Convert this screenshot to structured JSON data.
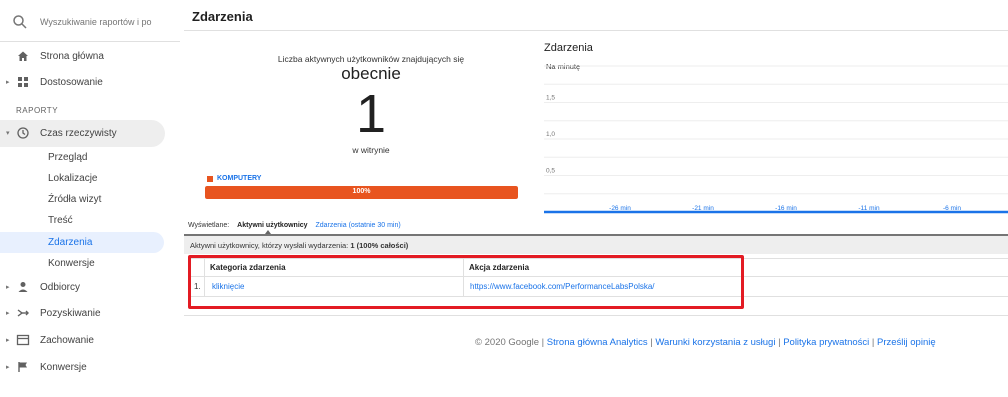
{
  "search": {
    "placeholder": "Wyszukiwanie raportów i po"
  },
  "sidebar": {
    "home": "Strona główna",
    "customize": "Dostosowanie",
    "section_reports": "RAPORTY",
    "realtime": "Czas rzeczywisty",
    "realtime_items": [
      "Przegląd",
      "Lokalizacje",
      "Źródła wizyt",
      "Treść",
      "Zdarzenia",
      "Konwersje"
    ],
    "active_item": "Zdarzenia",
    "audience": "Odbiorcy",
    "acquisition": "Pozyskiwanie",
    "behavior": "Zachowanie",
    "conversions": "Konwersje"
  },
  "page": {
    "title": "Zdarzenia"
  },
  "active_users": {
    "caption": "Liczba aktywnych użytkowników znajdujących się",
    "now": "obecnie",
    "count": "1",
    "on_site": "w witrynie",
    "device": "KOMPUTERY",
    "device_share_label": "100%",
    "device_share": 1.0,
    "device_color": "#e8541f"
  },
  "chart": {
    "title": "Zdarzenia",
    "subtitle": "Na minutę",
    "y_ticks": [
      "1,5",
      "1,0",
      "0,5"
    ],
    "x_ticks": [
      "-26 min",
      "-21 min",
      "-16 min",
      "-11 min",
      "-6 min"
    ],
    "line_color": "#1a73e8"
  },
  "chart_data": {
    "type": "line",
    "title": "Zdarzenia",
    "subtitle": "Na minutę",
    "x": [
      "-26 min",
      "-21 min",
      "-16 min",
      "-11 min",
      "-6 min"
    ],
    "y_ticks": [
      1.5,
      1.0,
      0.5
    ],
    "ylim": [
      0,
      2
    ],
    "series": [
      {
        "values": [
          0,
          0,
          0,
          0,
          0
        ]
      }
    ],
    "grid": true
  },
  "tabs": {
    "label": "Wyświetlane:",
    "active": "Aktywni użytkownicy",
    "other": "Zdarzenia (ostatnie 30 min)"
  },
  "summary": {
    "prefix": "Aktywni użytkownicy, którzy wysłali wydarzenia:",
    "value": "1",
    "pct": "(100% całości)"
  },
  "table": {
    "col_category": "Kategoria zdarzenia",
    "col_action": "Akcja zdarzenia",
    "rows": [
      {
        "index": "1.",
        "category": "kliknięcie",
        "action": "https://www.facebook.com/PerformanceLabsPolska/"
      }
    ]
  },
  "footer": {
    "copyright": "© 2020 Google |",
    "links": [
      "Strona główna Analytics",
      "Warunki korzystania z usługi",
      "Polityka prywatności",
      "Prześlij opinię"
    ]
  },
  "colors": {
    "accent": "#1a73e8",
    "highlight": "#e31b23",
    "bar": "#e8541f"
  }
}
